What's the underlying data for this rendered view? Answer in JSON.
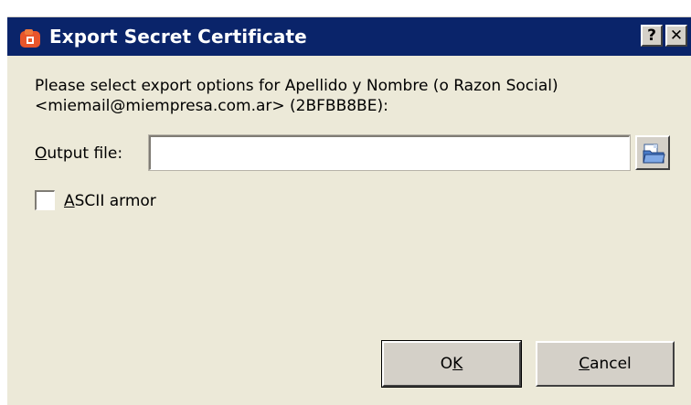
{
  "window": {
    "title": "Export Secret Certificate",
    "help_button": "?",
    "close_button": "✕"
  },
  "description": {
    "line1": "Please select export options for Apellido y Nombre (o Razon Social)",
    "line2": "<miemail@miempresa.com.ar> (2BFBB8BE):"
  },
  "output_file": {
    "label_mnemonic": "O",
    "label_rest": "utput file:",
    "value": "",
    "browse_icon": "folder-open-icon"
  },
  "ascii_armor": {
    "label_mnemonic": "A",
    "label_rest": "SCII armor",
    "checked": false
  },
  "buttons": {
    "ok_prefix": "O",
    "ok_mnemonic": "K",
    "cancel_mnemonic": "C",
    "cancel_rest": "ancel"
  },
  "colors": {
    "titlebar": "#0a246a",
    "dialog_bg": "#ece9d8"
  }
}
